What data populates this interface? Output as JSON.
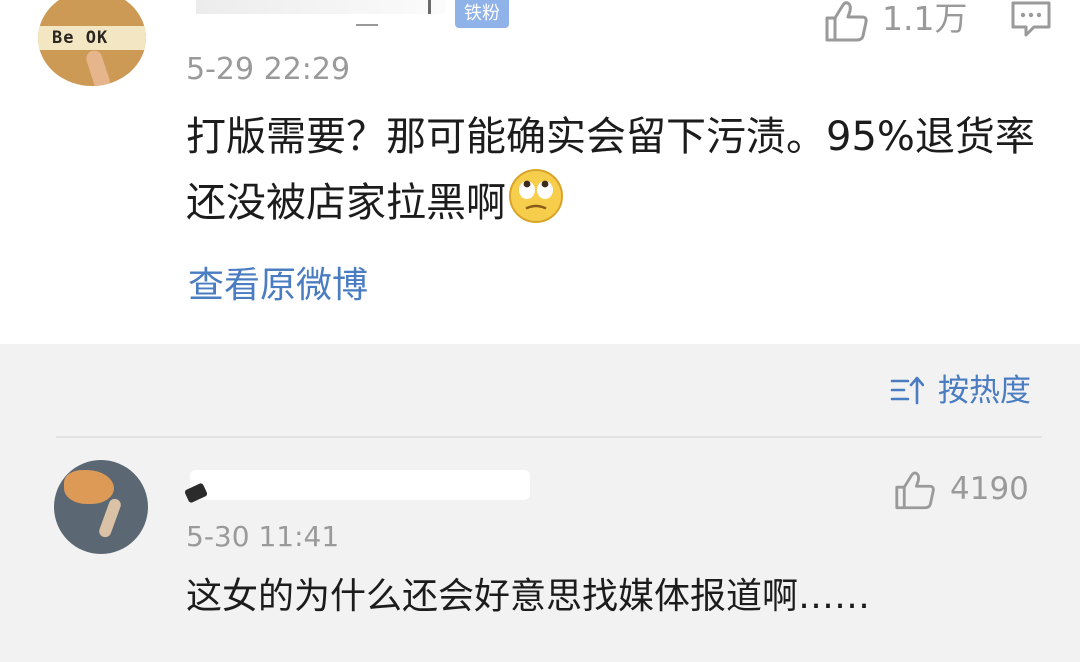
{
  "comment1": {
    "badge": "铁粉",
    "likes": "1.1万",
    "time": "5-29 22:29",
    "content": "打版需要？那可能确实会留下污渍。95%退货率还没被店家拉黑啊",
    "emoji": "rolling-eyes-emoji",
    "avatar_text": "Be OK",
    "view_original": "查看原微博"
  },
  "sort": {
    "label": "按热度",
    "icon": "sort-icon"
  },
  "comment2": {
    "likes": "4190",
    "time": "5-30 11:41",
    "content": "这女的为什么还会好意思找媒体报道啊……"
  },
  "colors": {
    "link": "#4a7cc2",
    "meta": "#9a9a9a",
    "text": "#1c1c1c",
    "badge": "#8fb2e8",
    "section_bg": "#f2f2f2"
  }
}
